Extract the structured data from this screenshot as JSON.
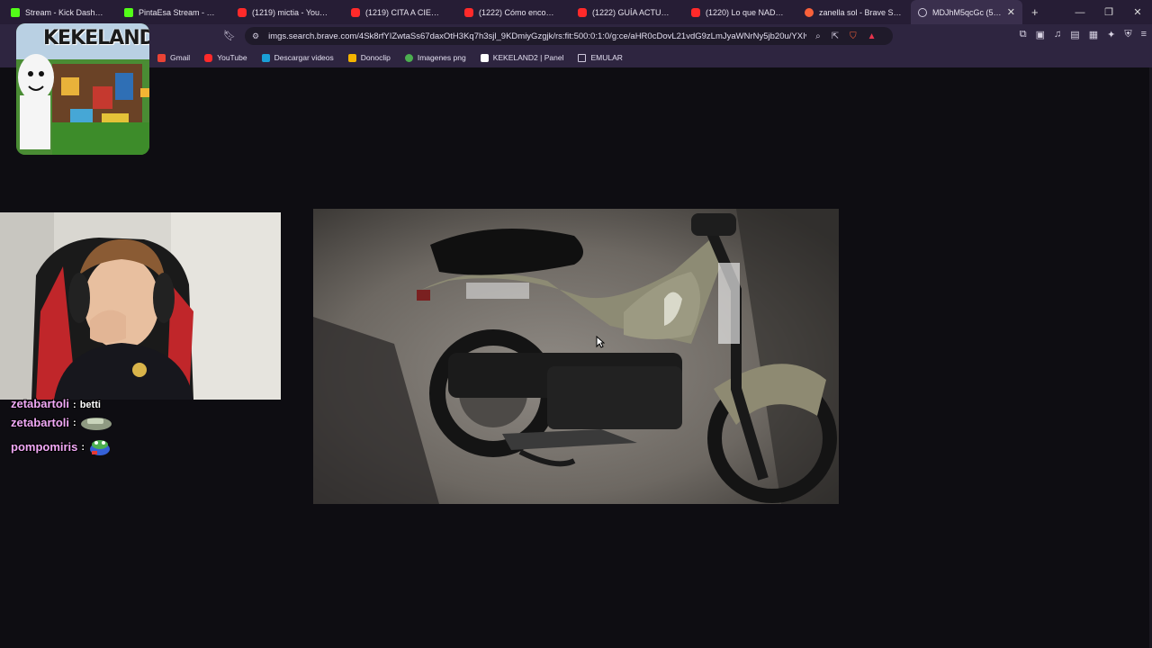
{
  "tabs": [
    {
      "title": "Stream - Kick Dashboa",
      "icon": "kick-icon"
    },
    {
      "title": "PintaEsa Stream - Wat",
      "icon": "kick-icon"
    },
    {
      "title": "(1219) mictia - YouTube",
      "icon": "youtube-icon"
    },
    {
      "title": "(1219) CITA A CIEGAS BA",
      "icon": "youtube-icon"
    },
    {
      "title": "(1222) Cómo encontrar el",
      "icon": "youtube-icon"
    },
    {
      "title": "(1222) GUÍA ACTUALIZAD",
      "icon": "youtube-icon"
    },
    {
      "title": "(1220) Lo que NADIE te c",
      "icon": "youtube-icon"
    },
    {
      "title": "zanella sol - Brave Search",
      "icon": "brave-icon"
    },
    {
      "title": "MDJhM5qcGc (500×",
      "icon": "globe-icon"
    }
  ],
  "address": {
    "url": "imgs.search.brave.com/4Sk8rfYIZwtaSs67daxOtH3Kq7h3sjl_9KDmiyGzgjk/rs:fit:500:0:1:0/g:ce/aHR0cDovL21vdG9zLmJyaWNrNy5jb20u/YXIvbW..."
  },
  "bookmarks": [
    {
      "label": "Gmail",
      "icon": "gmail-icon"
    },
    {
      "label": "YouTube",
      "icon": "youtube-icon"
    },
    {
      "label": "Descargar videos",
      "icon": "download-icon"
    },
    {
      "label": "Donoclip",
      "icon": "donoclip-icon"
    },
    {
      "label": "Imagenes png",
      "icon": "image-icon"
    },
    {
      "label": "KEKELAND2 | Panel",
      "icon": "panel-icon"
    },
    {
      "label": "EMULAR",
      "icon": "folder-icon"
    }
  ],
  "overlay": {
    "logo_text": "KEKELAND"
  },
  "chat": [
    {
      "user": "zetabartoli",
      "separator": ":",
      "message": "betti"
    },
    {
      "user": "zetabartoli",
      "separator": ":",
      "message": ""
    },
    {
      "user": "pompomiris",
      "separator": ":",
      "message": ""
    }
  ],
  "colors": {
    "tabbar": "#261d35",
    "toolbar": "#2e2540",
    "page_bg": "#0e0d12",
    "chat_username": "#f0a8f5"
  }
}
